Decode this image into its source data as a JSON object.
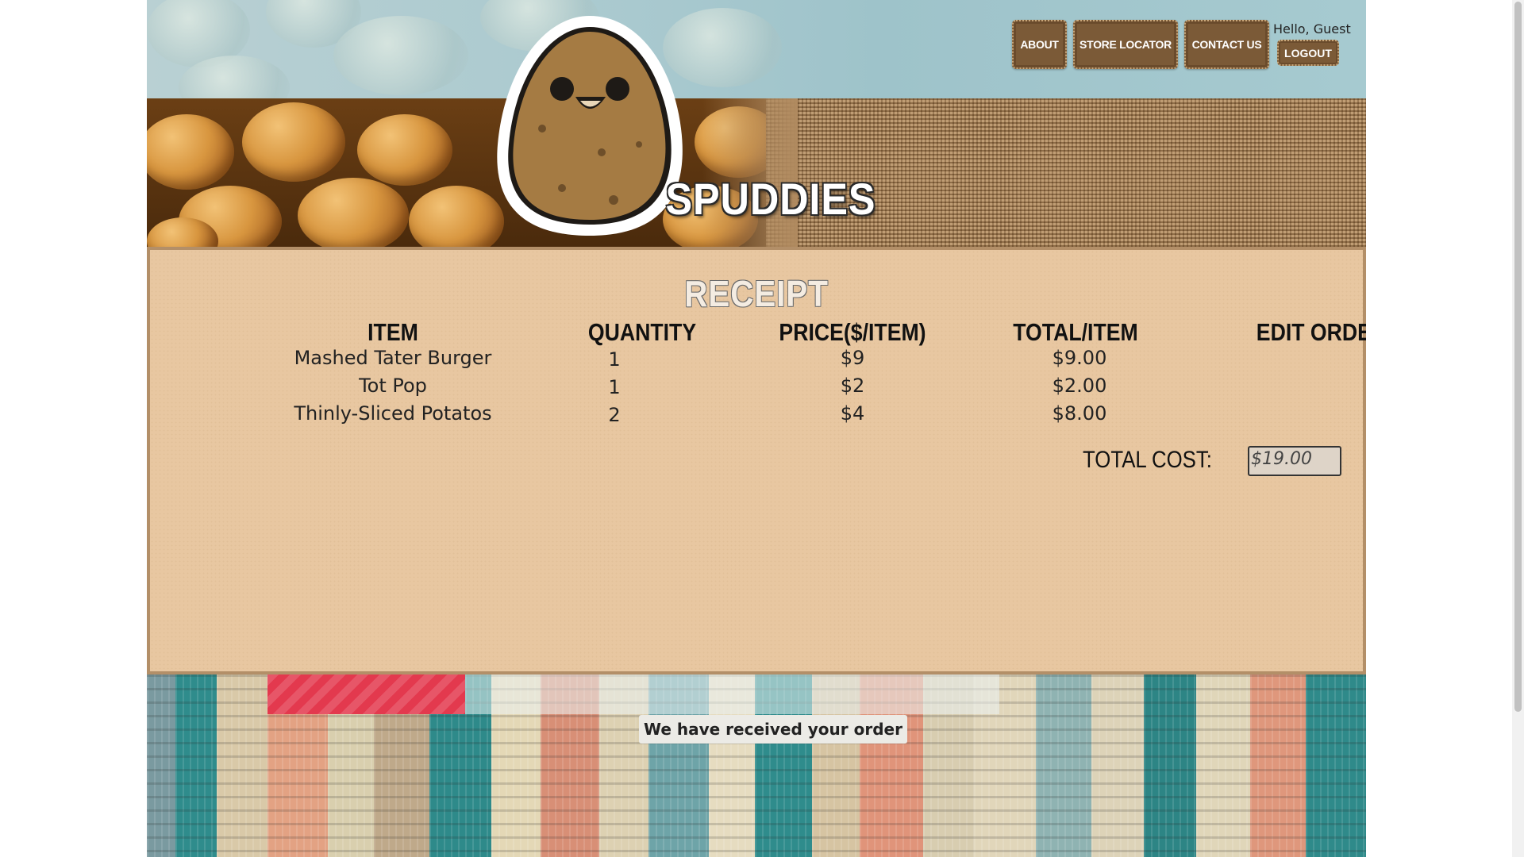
{
  "header": {
    "site_title": "SPUDDIES",
    "nav": [
      {
        "label": "ABOUT"
      },
      {
        "label": "STORE LOCATOR"
      },
      {
        "label": "CONTACT US"
      }
    ],
    "greeting": "Hello, Guest",
    "logout_label": "LOGOUT"
  },
  "receipt": {
    "title": "RECEIPT",
    "columns": [
      "ITEM",
      "QUANTITY",
      "PRICE($/ITEM)",
      "TOTAL/ITEM",
      "EDIT ORDER"
    ],
    "rows": [
      {
        "item": "Mashed Tater Burger",
        "quantity": "1",
        "price": "$9",
        "total": "$9.00"
      },
      {
        "item": "Tot Pop",
        "quantity": "1",
        "price": "$2",
        "total": "$2.00"
      },
      {
        "item": "Thinly-Sliced Potatos",
        "quantity": "2",
        "price": "$4",
        "total": "$8.00"
      }
    ],
    "total_label": "TOTAL COST:",
    "total_value": "$19.00"
  },
  "footer": {
    "order_progress": 0.27,
    "status_message": "We have received your order"
  },
  "colors": {
    "button_brown": "#7b5a37",
    "panel_tan": "#e8c7a1",
    "progress_red": "#e3394e"
  }
}
